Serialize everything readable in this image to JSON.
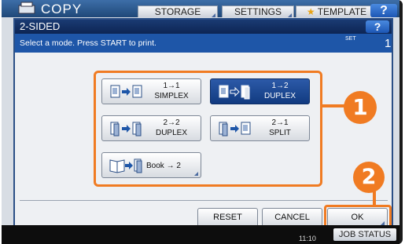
{
  "header": {
    "app_title": "COPY",
    "tabs": [
      "STORAGE",
      "SETTINGS",
      "TEMPLATE"
    ],
    "help": "?"
  },
  "dialog": {
    "title": "2-SIDED",
    "help": "?",
    "instruction": "Select a mode. Press START to print.",
    "set_label": "SET",
    "set_count": "1",
    "modes": [
      {
        "line1": "1→1",
        "line2": "SIMPLEX",
        "selected": false
      },
      {
        "line1": "1→2",
        "line2": "DUPLEX",
        "selected": true
      },
      {
        "line1": "2→2",
        "line2": "DUPLEX",
        "selected": false
      },
      {
        "line1": "2→1",
        "line2": "SPLIT",
        "selected": false
      },
      {
        "line1": "Book → 2",
        "line2": "",
        "selected": false
      }
    ],
    "buttons": {
      "reset": "RESET",
      "cancel": "CANCEL",
      "ok": "OK"
    }
  },
  "callouts": [
    "1",
    "2"
  ],
  "status": {
    "clock": "11:10",
    "job_status": "JOB STATUS"
  },
  "colors": {
    "accent": "#f07b22",
    "dialog_title": "#0d2554",
    "info_bar": "#1e56a8",
    "selected": "#1e4c96"
  }
}
